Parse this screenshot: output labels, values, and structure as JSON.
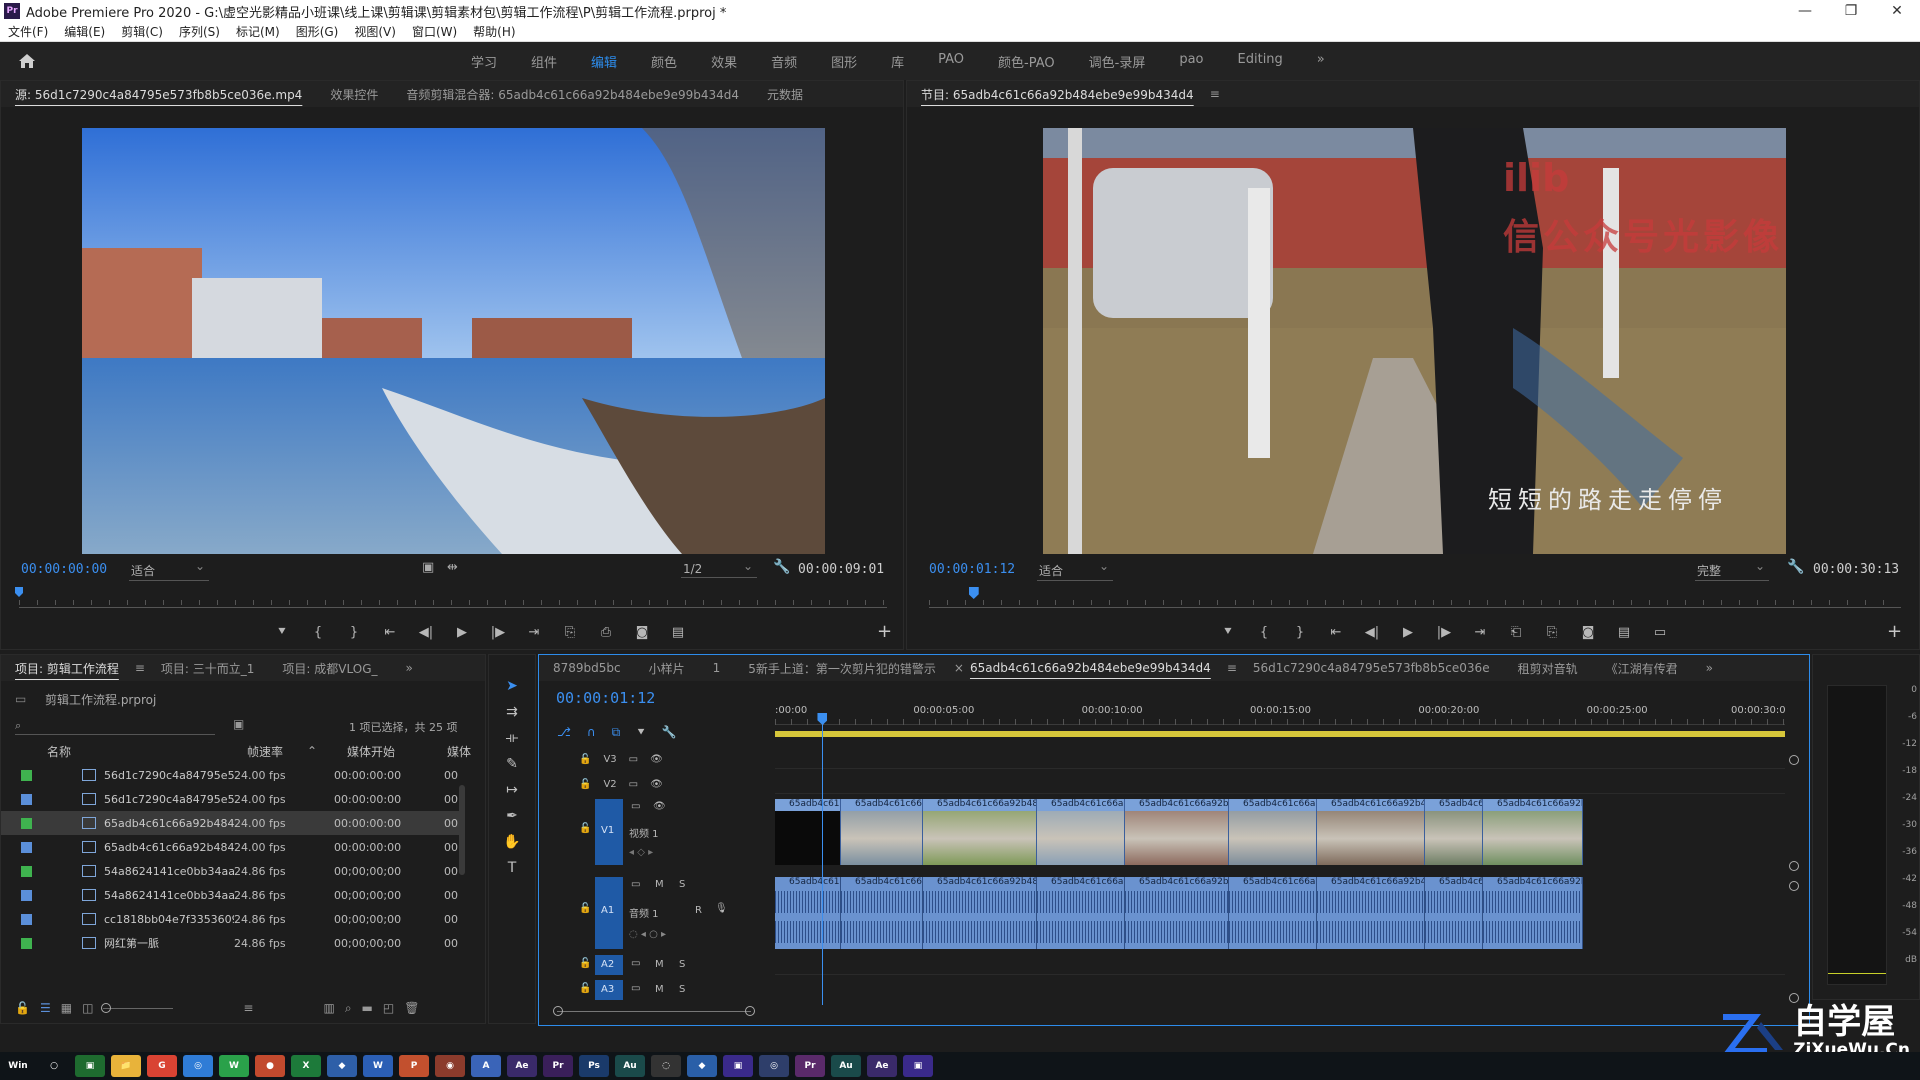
{
  "window": {
    "title": "Adobe Premiere Pro 2020 - G:\\虚空光影精品小班课\\线上课\\剪辑课\\剪辑素材包\\剪辑工作流程\\P\\剪辑工作流程.prproj *",
    "logo": "Pr",
    "controls": [
      "—",
      "❐",
      "✕"
    ]
  },
  "menu": [
    "文件(F)",
    "编辑(E)",
    "剪辑(C)",
    "序列(S)",
    "标记(M)",
    "图形(G)",
    "视图(V)",
    "窗口(W)",
    "帮助(H)"
  ],
  "workspaces": {
    "tabs": [
      "学习",
      "组件",
      "编辑",
      "颜色",
      "效果",
      "音频",
      "图形",
      "库",
      "PAO",
      "颜色-PAO",
      "调色-录屏",
      "pao",
      "Editing"
    ],
    "active": "编辑",
    "overflow": "»"
  },
  "source_panel": {
    "tabs": [
      "源: 56d1c7290c4a84795e573fb8b5ce036e.mp4",
      "效果控件",
      "音频剪辑混合器: 65adb4c61c66a92b484ebe9e99b434d4",
      "元数据"
    ],
    "timecode": "00:00:00:00",
    "fit": "适合",
    "resolution": "1/2",
    "duration": "00:00:09:01",
    "playhead_fraction": 0.0
  },
  "program_panel": {
    "title": "节目: 65adb4c61c66a92b484ebe9e99b434d4",
    "timecode": "00:00:01:12",
    "fit": "适合",
    "quality": "完整",
    "duration": "00:00:30:13",
    "overlay_text_1": "ilib",
    "overlay_text_2": "信公众号光影像",
    "subtitle": "短短的路走走停停",
    "playhead_fraction": 0.046
  },
  "transport_icons": [
    "marker-icon",
    "mark-in-icon",
    "mark-out-icon",
    "go-to-in-icon",
    "step-back-icon",
    "play-icon",
    "step-forward-icon",
    "go-to-out-icon",
    "insert-icon",
    "overwrite-icon",
    "export-frame-icon",
    "settings-icon"
  ],
  "project_panel": {
    "tabs": [
      "项目: 剪辑工作流程",
      "项目: 三十而立_1",
      "项目: 成都VLOG_"
    ],
    "overflow": "»",
    "file": "剪辑工作流程.prproj",
    "search_placeholder": "",
    "selection_info": "1 项已选择，共 25 项",
    "columns": [
      "名称",
      "帧速率",
      "媒体开始",
      "媒体"
    ],
    "rows": [
      {
        "name": "56d1c7290c4a84795e5",
        "fps": "24.00 fps",
        "start": "00:00:00:00",
        "c5": "00",
        "color": "#3fb34f"
      },
      {
        "name": "56d1c7290c4a84795e5",
        "fps": "24.00 fps",
        "start": "00:00:00:00",
        "c5": "00",
        "color": "#5b8fd9"
      },
      {
        "name": "65adb4c61c66a92b484",
        "fps": "24.00 fps",
        "start": "00:00:00:00",
        "c5": "00",
        "color": "#3fb34f"
      },
      {
        "name": "65adb4c61c66a92b484",
        "fps": "24.00 fps",
        "start": "00:00:00:00",
        "c5": "00",
        "color": "#5b8fd9"
      },
      {
        "name": "54a8624141ce0bb34aa",
        "fps": "24.86 fps",
        "start": "00;00;00;00",
        "c5": "00",
        "color": "#3fb34f"
      },
      {
        "name": "54a8624141ce0bb34aa",
        "fps": "24.86 fps",
        "start": "00;00;00;00",
        "c5": "00",
        "color": "#5b8fd9"
      },
      {
        "name": "cc1818bb04e7f3353609",
        "fps": "24.86 fps",
        "start": "00;00;00;00",
        "c5": "00",
        "color": "#5b8fd9"
      },
      {
        "name": "网红第一脈",
        "fps": "24.86 fps",
        "start": "00;00;00;00",
        "c5": "00",
        "color": "#3fb34f"
      }
    ]
  },
  "timeline_panel": {
    "tabs": [
      "8789bd5bc",
      "小样片",
      "1",
      "5新手上道：第一次剪片犯的错警示",
      "65adb4c61c66a92b484ebe9e99b434d4",
      "56d1c7290c4a84795e573fb8b5ce036e",
      "租剪对音轨",
      "《江湖有传君"
    ],
    "active_tab": "65adb4c61c66a92b484ebe9e99b434d4",
    "close_glyph": "×",
    "overflow": "»",
    "timecode": "00:00:01:12",
    "ruler_labels": [
      ":00:00",
      "00:00:05:00",
      "00:00:10:00",
      "00:00:15:00",
      "00:00:20:00",
      "00:00:25:00",
      "00:00:30:0"
    ],
    "tracks": {
      "video": [
        "V3",
        "V2",
        "V1"
      ],
      "audio": [
        "A1",
        "A2",
        "A3"
      ],
      "v1_name": "视频 1",
      "a1_name": "音频 1",
      "m": "M",
      "s": "S",
      "r": "R"
    },
    "video_clips": [
      "65adb4c61c",
      "65adb4c61c66a",
      "65adb4c61c66a92b484ebe",
      "65adb4c61c66a92b",
      "65adb4c61c66a92b484e",
      "65adb4c61c66a9",
      "65adb4c61c66a92b484e",
      "65adb4c6",
      "65adb4c61c66a92b484"
    ],
    "audio_clips": [
      "65adb4c61c",
      "65adb4c61c66a",
      "65adb4c61c66a92b484ebe",
      "65adb4c61c66a92b",
      "65adb4c61c66a92b484e",
      "65adb4c61c66a9",
      "65adb4c61c66a92b484e",
      "65adb4c6",
      "65adb4c61c66a92b484"
    ],
    "playhead_fraction": 0.047
  },
  "audio_meter": {
    "labels": [
      "0",
      "-6",
      "-12",
      "-18",
      "-24",
      "-30",
      "-36",
      "-42",
      "-48",
      "-54",
      "dB"
    ]
  },
  "tools": [
    "selection-tool-icon",
    "track-select-icon",
    "ripple-edit-icon",
    "razor-icon",
    "slip-icon",
    "pen-icon",
    "hand-icon",
    "type-icon"
  ],
  "watermark": {
    "cn": "自学屋",
    "url": "ZiXueWu.Cn"
  },
  "taskbar": {
    "apps": [
      "Win",
      "○",
      "▣",
      "📁",
      "G",
      "◎",
      "W",
      "●",
      "X",
      "◆",
      "W",
      "P",
      "◉",
      "A",
      "Ae",
      "Pr",
      "Ps",
      "Au",
      "◌",
      "◆",
      "▣",
      "◎",
      "Pr",
      "Au",
      "Ae",
      "▣"
    ]
  },
  "colors": {
    "accent": "#2d8ceb",
    "video_clip": "#7aa1d9",
    "audio_clip": "#6a92cf",
    "work_area": "#d6c63a"
  }
}
